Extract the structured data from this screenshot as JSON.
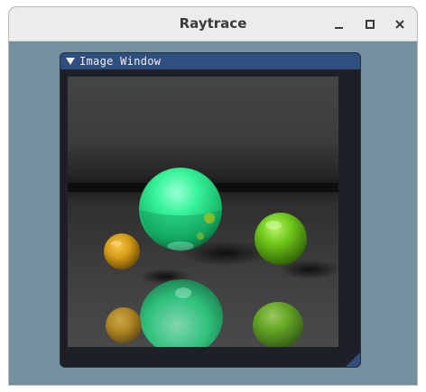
{
  "window": {
    "title": "Raytrace",
    "controls": {
      "minimize": "minimize-icon",
      "maximize": "maximize-icon",
      "close": "close-icon"
    }
  },
  "image_window": {
    "title": "Image Window",
    "collapse_icon": "triangle-down-icon"
  },
  "colors": {
    "titlebar": "#ececec",
    "background": "#74909e",
    "panel": "#1d2026",
    "panel_header": "#2e4f7f",
    "sphere_green_center": "#3af59c",
    "sphere_green_right": "#6fc81a",
    "sphere_orange": "#d39a16"
  }
}
